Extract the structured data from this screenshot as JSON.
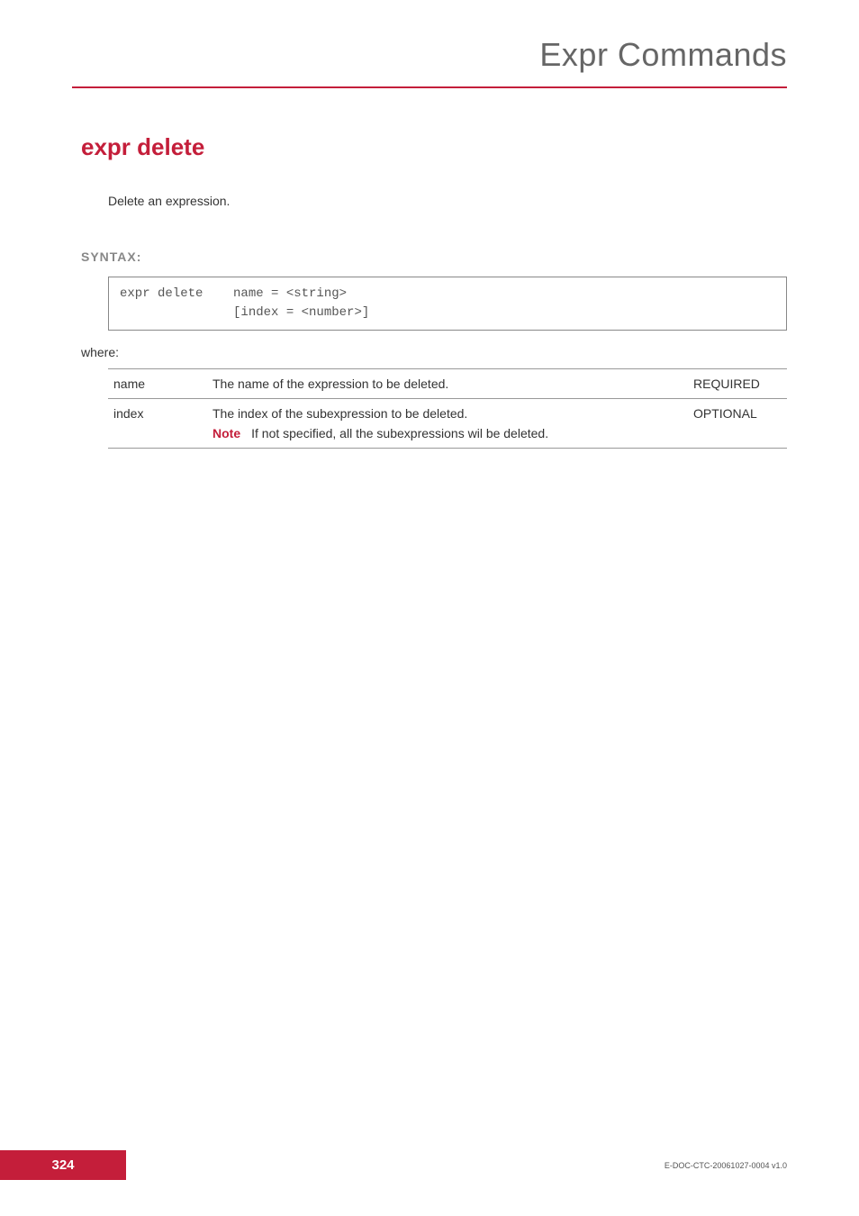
{
  "header": {
    "title": "Expr Commands"
  },
  "section": {
    "title": "expr delete",
    "description": "Delete an expression."
  },
  "syntax": {
    "label": "SYNTAX:",
    "code": "expr delete    name = <string>\n               [index = <number>]"
  },
  "where_label": "where:",
  "params": [
    {
      "name": "name",
      "desc": "The name of the expression to be deleted.",
      "req": "REQUIRED"
    },
    {
      "name": "index",
      "desc": "The index of the subexpression to be deleted.",
      "req": "OPTIONAL",
      "note_label": "Note",
      "note_text": "If not specified, all the subexpressions wil be deleted."
    }
  ],
  "footer": {
    "page": "324",
    "docid": "E-DOC-CTC-20061027-0004 v1.0"
  }
}
